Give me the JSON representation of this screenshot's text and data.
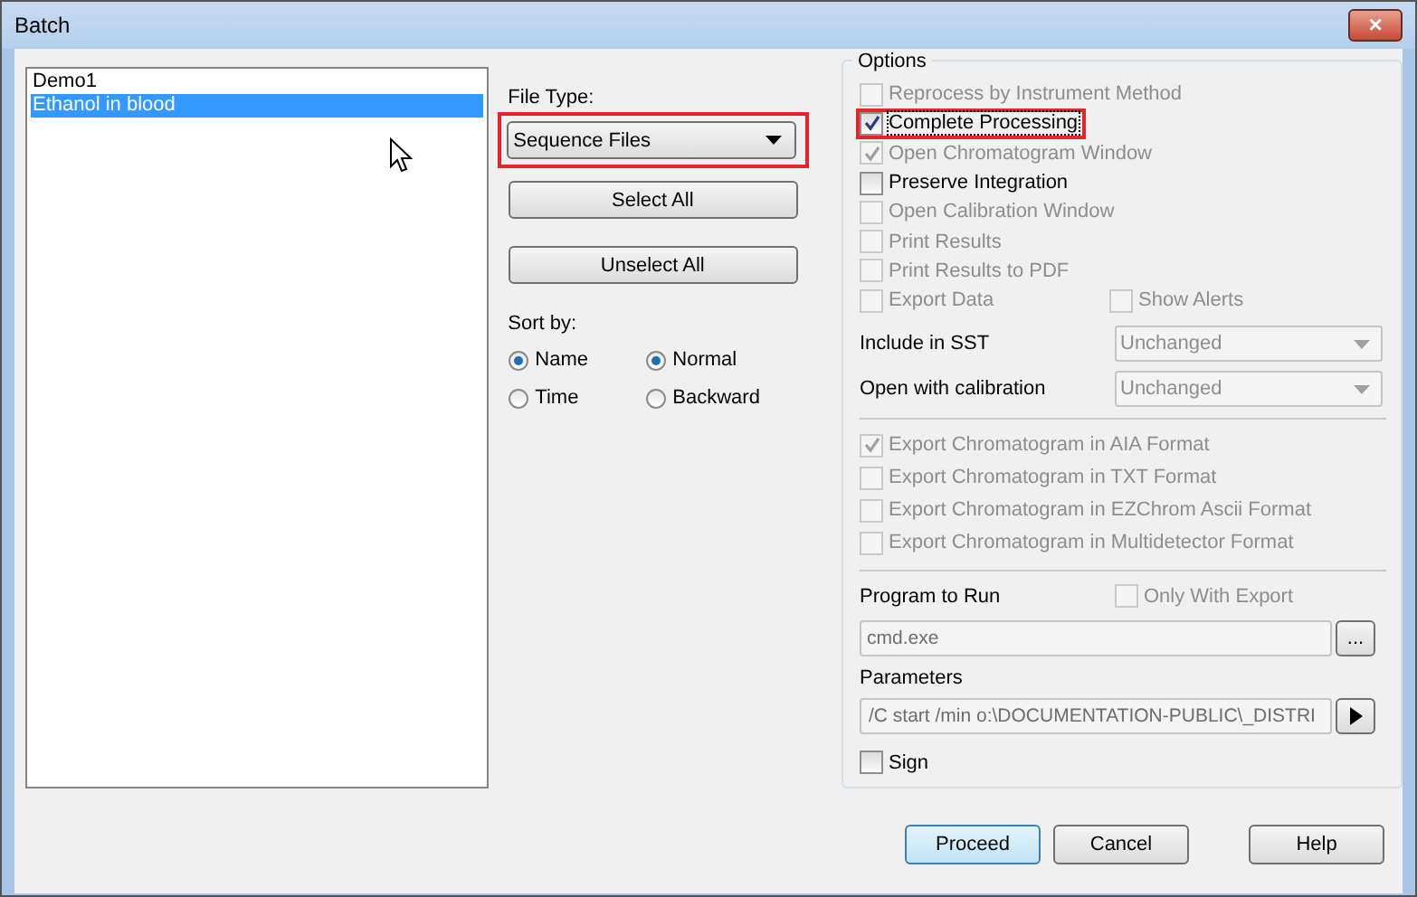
{
  "window": {
    "title": "Batch",
    "close": "×"
  },
  "list": [
    {
      "label": "Demo1",
      "selected": false
    },
    {
      "label": "Ethanol in blood",
      "selected": true
    }
  ],
  "file_type": {
    "label": "File Type:",
    "value": "Sequence Files",
    "highlighted": true
  },
  "select_all": "Select All",
  "unselect_all": "Unselect All",
  "sort_by": {
    "label": "Sort by:",
    "options": [
      {
        "label": "Name",
        "selected": true
      },
      {
        "label": "Normal",
        "selected": true
      },
      {
        "label": "Time",
        "selected": false
      },
      {
        "label": "Backward",
        "selected": false
      }
    ]
  },
  "options": {
    "title": "Options",
    "checks": [
      {
        "label": "Reprocess by Instrument Method",
        "checked": false,
        "disabled": true,
        "highlighted": false
      },
      {
        "label": "Complete Processing",
        "checked": true,
        "disabled": false,
        "highlighted": true
      },
      {
        "label": "Open Chromatogram Window",
        "checked": true,
        "disabled": true,
        "highlighted": false
      },
      {
        "label": "Preserve Integration",
        "checked": false,
        "disabled": false,
        "highlighted": false
      },
      {
        "label": "Open Calibration Window",
        "checked": false,
        "disabled": true,
        "highlighted": false
      },
      {
        "label": "Print Results",
        "checked": false,
        "disabled": true,
        "highlighted": false
      },
      {
        "label": "Print Results to PDF",
        "checked": false,
        "disabled": true,
        "highlighted": false
      }
    ],
    "export_data": {
      "label": "Export Data",
      "checked": false,
      "disabled": true
    },
    "show_alerts": {
      "label": "Show Alerts",
      "checked": false,
      "disabled": true
    },
    "selects": [
      {
        "label": "Include in SST",
        "value": "Unchanged"
      },
      {
        "label": "Open with calibration",
        "value": "Unchanged"
      }
    ],
    "exports": [
      {
        "label": "Export Chromatogram in AIA Format",
        "checked": true,
        "disabled": true
      },
      {
        "label": "Export Chromatogram in TXT Format",
        "checked": false,
        "disabled": true
      },
      {
        "label": "Export Chromatogram in EZChrom Ascii Format",
        "checked": false,
        "disabled": true
      },
      {
        "label": "Export Chromatogram in Multidetector Format",
        "checked": false,
        "disabled": true
      }
    ],
    "program_label": "Program to Run",
    "only_with_export": {
      "label": "Only With Export",
      "checked": false,
      "disabled": true
    },
    "program": "cmd.exe",
    "browse": "...",
    "parameters_label": "Parameters",
    "parameters": "/C start /min o:\\DOCUMENTATION-PUBLIC\\_DISTRI",
    "sign": {
      "label": "Sign",
      "checked": false,
      "disabled": false
    }
  },
  "buttons": [
    {
      "label": "Proceed",
      "default": true
    },
    {
      "label": "Cancel",
      "default": false
    },
    {
      "label": "Help",
      "default": false
    }
  ]
}
